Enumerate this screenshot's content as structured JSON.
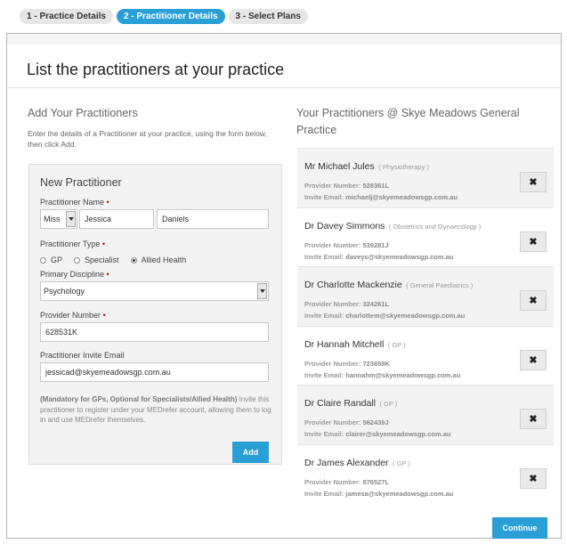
{
  "steps": [
    {
      "label": "1 - Practice Details",
      "active": false
    },
    {
      "label": "2 - Practitioner Details",
      "active": true
    },
    {
      "label": "3 - Select Plans",
      "active": false
    }
  ],
  "page_title": "List the practitioners at your practice",
  "left": {
    "heading": "Add Your Practitioners",
    "intro": "Enter the details of a Practitioner at your practice, using the form below, then click Add."
  },
  "form": {
    "title": "New Practitioner",
    "name_label": "Practitioner Name",
    "title_value": "Miss",
    "first_name": "Jessica",
    "last_name": "Daniels",
    "type_label": "Practitioner Type",
    "type_options": [
      "GP",
      "Specialist",
      "Allied Health"
    ],
    "type_selected": "Allied Health",
    "discipline_label": "Primary Discipline",
    "discipline_value": "Psychology",
    "provider_label": "Provider Number",
    "provider_value": "628531K",
    "email_label": "Practitioner Invite Email",
    "email_value": "jessicad@skyemeadowsgp.com.au",
    "note_bold": "(Mandatory for GPs, Optional for Specialists/Allied Health)",
    "note_rest": " Invite this practitioner to register under your MEDrefer account, allowing them to log in and use MEDrefer themselves.",
    "add_label": "Add"
  },
  "right": {
    "heading": "Your Practitioners @ Skye Meadows General Practice"
  },
  "practitioners": [
    {
      "name": "Mr Michael Jules",
      "spec": "( Physiotherapy )",
      "provider": "528361L",
      "email": "michaelj@skyemeadowsgp.com.au"
    },
    {
      "name": "Dr Davey Simmons",
      "spec": "( Obstetrics and Gynaecology )",
      "provider": "539281J",
      "email": "daveys@skyemeadowsgp.com.au"
    },
    {
      "name": "Dr Charlotte Mackenzie",
      "spec": "( General Paediatrics )",
      "provider": "324261L",
      "email": "charlottem@skyemeadowsgp.com.au"
    },
    {
      "name": "Dr Hannah Mitchell",
      "spec": "( GP )",
      "provider": "723659K",
      "email": "hannahm@skyemeadowsgp.com.au"
    },
    {
      "name": "Dr Claire Randall",
      "spec": "( GP )",
      "provider": "562439J",
      "email": "clairer@skyemeadowsgp.com.au"
    },
    {
      "name": "Dr James Alexander",
      "spec": "( GP )",
      "provider": "876527L",
      "email": "jamesa@skyemeadowsgp.com.au"
    }
  ],
  "card_labels": {
    "provider": "Provider Number: ",
    "email": "Invite Email: ",
    "remove": "✖"
  },
  "continue_label": "Continue",
  "colors": {
    "accent": "#2a9fd6",
    "required": "#cc0000"
  }
}
